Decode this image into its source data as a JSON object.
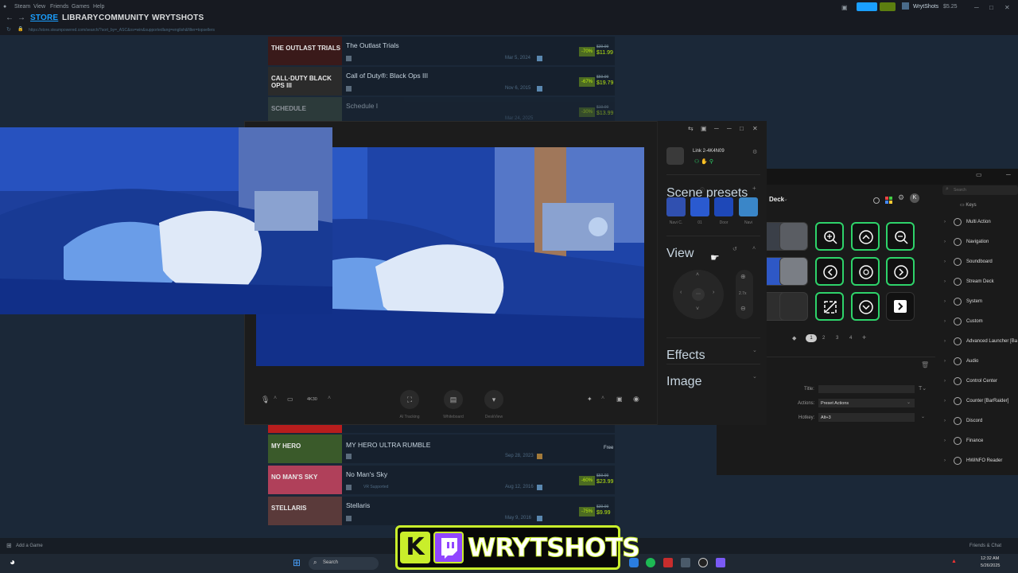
{
  "steam": {
    "menu": [
      "Steam",
      "View",
      "Friends",
      "Games",
      "Help"
    ],
    "tabs": [
      "STORE",
      "LIBRARY",
      "COMMUNITY",
      "WRYTSHOTS"
    ],
    "url": "https://store.steampowered.com/search/?sort_by=_ASC&os=win&supportedlang=english&filter=topsellers",
    "account": "WrytShots",
    "wallet": "$5.25",
    "add_game": "Add a Game",
    "friends_chat": "Friends & Chat"
  },
  "store_rows": [
    {
      "title": "The Outlast Trials",
      "thumb": "THE OUTLAST TRIALS",
      "date": "Mar 5, 2024",
      "discount": "-70%",
      "orig": "$39.99",
      "final": "$11.99",
      "thumb_color": "#3a1a1a"
    },
    {
      "title": "Call of Duty®: Black Ops III",
      "thumb": "CALL·DUTY BLACK OPS III",
      "date": "Nov 6, 2015",
      "discount": "-67%",
      "orig": "$59.99",
      "final": "$19.79",
      "thumb_color": "#2b2b2b"
    },
    {
      "title": "Schedule I",
      "thumb": "SCHEDULE",
      "date": "Mar 24, 2025",
      "discount": "-30%",
      "orig": "$19.99",
      "final": "$13.99",
      "thumb_color": "#3b4a3c"
    },
    {
      "title": "MY HERO ULTRA RUMBLE",
      "thumb": "MY HERO",
      "date": "Sep 28, 2023",
      "price": "Free",
      "thumb_color": "#3a5a2a"
    },
    {
      "title": "No Man's Sky",
      "thumb": "NO MAN'S SKY",
      "subtag": "VR Supported",
      "date": "Aug 12, 2016",
      "discount": "-60%",
      "orig": "$59.99",
      "final": "$23.99",
      "thumb_color": "#b0405a"
    },
    {
      "title": "Stellaris",
      "thumb": "STELLARIS",
      "date": "May 9, 2016",
      "discount": "-75%",
      "orig": "$39.99",
      "final": "$9.99",
      "thumb_color": "#5a3a3a"
    }
  ],
  "cam": {
    "device_name": "Link 2-4K4N09",
    "scene_presets_label": "Scene presets",
    "presets": [
      "Navi C.",
      "01",
      "Door",
      "Navi"
    ],
    "view_label": "View",
    "zoom": "2.7x",
    "effects_label": "Effects",
    "image_label": "Image",
    "resolution": "4K30",
    "tools": [
      "AI Tracking",
      "Whiteboard",
      "DeskView"
    ]
  },
  "deck": {
    "title": "Deck",
    "search_placeholder": "Search",
    "keys_tab": "Keys",
    "pages": [
      "1",
      "2",
      "3",
      "4"
    ],
    "fields": {
      "title_label": "Title:",
      "actions_label": "Actions:",
      "actions_value": "Preset Actions",
      "hotkey_label": "Hotkey:",
      "hotkey_value": "Alt+3"
    },
    "categories": [
      "Multi Action",
      "Navigation",
      "Soundboard",
      "Stream Deck",
      "System",
      "Custom",
      "Advanced Launcher [Ba",
      "Audio",
      "Control Center",
      "Counter [BarRaider]",
      "Discord",
      "Finance",
      "HWiNFO Reader"
    ]
  },
  "taskbar": {
    "search": "Search",
    "time": "12:32 AM",
    "date": "5/26/2025"
  },
  "banner": {
    "text": "WRYTSHOTS"
  },
  "colors": {
    "steam_blue": "#1a9fff",
    "discount_green": "#beee11",
    "deck_green": "#2ed36a",
    "banner_lime": "#c9ee2b",
    "twitch_purple": "#9146ff"
  }
}
